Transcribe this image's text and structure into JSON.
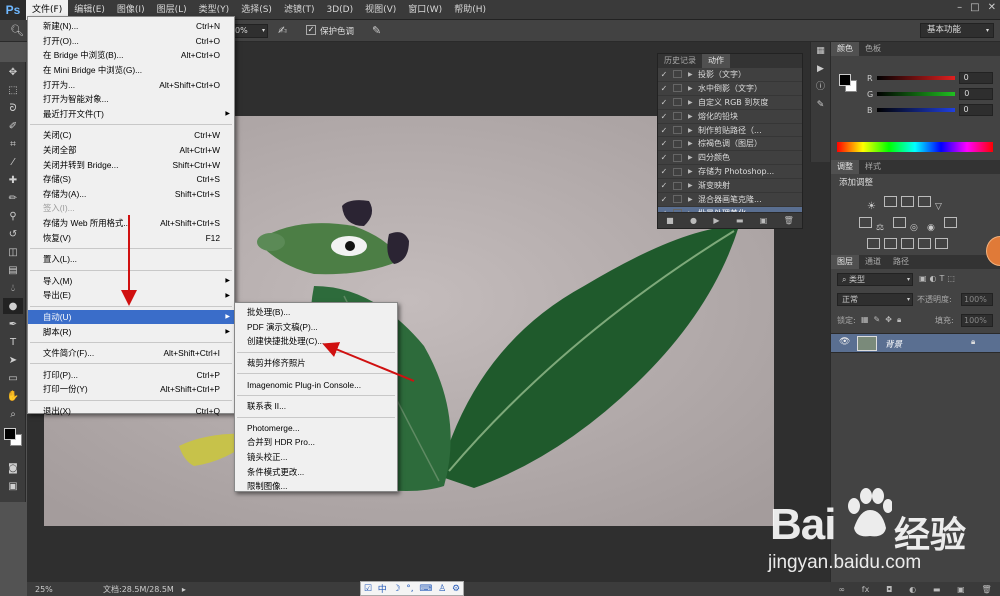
{
  "app": {
    "logo": "Ps"
  },
  "menubar": {
    "items": [
      "文件(F)",
      "编辑(E)",
      "图像(I)",
      "图层(L)",
      "类型(Y)",
      "选择(S)",
      "滤镜(T)",
      "3D(D)",
      "视图(V)",
      "窗口(W)",
      "帮助(H)"
    ],
    "active_index": 0
  },
  "optionsbar": {
    "zoom_value": "0%",
    "protect_tone": "保护色调",
    "workspace": "基本功能"
  },
  "file_menu": {
    "items": [
      {
        "label": "新建(N)...",
        "shortcut": "Ctrl+N"
      },
      {
        "label": "打开(O)...",
        "shortcut": "Ctrl+O"
      },
      {
        "label": "在 Bridge 中浏览(B)...",
        "shortcut": "Alt+Ctrl+O"
      },
      {
        "label": "在 Mini Bridge 中浏览(G)...",
        "shortcut": ""
      },
      {
        "label": "打开为...",
        "shortcut": "Alt+Shift+Ctrl+O"
      },
      {
        "label": "打开为智能对象...",
        "shortcut": ""
      },
      {
        "label": "最近打开文件(T)",
        "shortcut": ""
      },
      {
        "label": "关闭(C)",
        "shortcut": "Ctrl+W"
      },
      {
        "label": "关闭全部",
        "shortcut": "Alt+Ctrl+W"
      },
      {
        "label": "关闭并转到 Bridge...",
        "shortcut": "Shift+Ctrl+W"
      },
      {
        "label": "存储(S)",
        "shortcut": "Ctrl+S"
      },
      {
        "label": "存储为(A)...",
        "shortcut": "Shift+Ctrl+S"
      },
      {
        "label": "签入(I)...",
        "shortcut": ""
      },
      {
        "label": "存储为 Web 所用格式...",
        "shortcut": "Alt+Shift+Ctrl+S"
      },
      {
        "label": "恢复(V)",
        "shortcut": "F12"
      },
      {
        "label": "置入(L)...",
        "shortcut": ""
      },
      {
        "label": "导入(M)",
        "shortcut": ""
      },
      {
        "label": "导出(E)",
        "shortcut": ""
      },
      {
        "label": "自动(U)",
        "shortcut": ""
      },
      {
        "label": "脚本(R)",
        "shortcut": ""
      },
      {
        "label": "文件简介(F)...",
        "shortcut": "Alt+Shift+Ctrl+I"
      },
      {
        "label": "打印(P)...",
        "shortcut": "Ctrl+P"
      },
      {
        "label": "打印一份(Y)",
        "shortcut": "Alt+Shift+Ctrl+P"
      },
      {
        "label": "退出(X)",
        "shortcut": "Ctrl+Q"
      }
    ]
  },
  "auto_submenu": {
    "items": [
      "批处理(B)...",
      "PDF 演示文稿(P)...",
      "创建快捷批处理(C)...",
      "裁剪并修齐照片",
      "Imagenomic Plug-in Console...",
      "联系表 II...",
      "Photomerge...",
      "合并到 HDR Pro...",
      "镜头校正...",
      "条件模式更改...",
      "限制图像..."
    ]
  },
  "actions_panel": {
    "tabs": [
      "历史记录",
      "动作"
    ],
    "rows": [
      "投影（文字）",
      "水中倒影（文字）",
      "自定义 RGB 到灰度",
      "熔化的铅块",
      "制作剪贴路径（...",
      "棕褐色调（图层）",
      "四分颜色",
      "存储为 Photoshop...",
      "渐变映射",
      "混合器画笔克隆...",
      "批量处理美化"
    ]
  },
  "color_panel": {
    "tabs": [
      "颜色",
      "色板"
    ],
    "channels": [
      {
        "name": "R",
        "value": "0",
        "color": "#e02020"
      },
      {
        "name": "G",
        "value": "0",
        "color": "#20c020"
      },
      {
        "name": "B",
        "value": "0",
        "color": "#2040e0"
      }
    ]
  },
  "adjust_panel": {
    "tabs": [
      "调整",
      "样式"
    ],
    "title": "添加调整"
  },
  "layers_panel": {
    "tabs": [
      "图层",
      "通道",
      "路径"
    ],
    "kind_filter": "类型",
    "blend_mode": "正常",
    "opacity_label": "不透明度:",
    "opacity_value": "100%",
    "lock_label": "锁定:",
    "fill_label": "填充:",
    "fill_value": "100%",
    "layer_name": "背景"
  },
  "status": {
    "zoom": "25%",
    "doc": "文档:28.5M/28.5M"
  },
  "ime_bar": {
    "text": "中"
  },
  "watermark": {
    "brand": "Bai",
    "brand2": "经验",
    "url": "jingyan.baidu.com"
  }
}
